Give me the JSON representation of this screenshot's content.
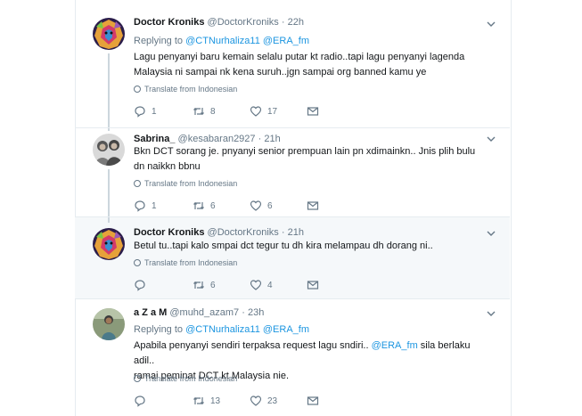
{
  "translate_label": "Translate from Indonesian",
  "tweets": [
    {
      "name": "Doctor Kroniks",
      "handle": "@DoctorKroniks",
      "time": "22h",
      "replying_prefix": "Replying to",
      "replying_to": [
        "@CTNurhaliza11",
        "@ERA_fm"
      ],
      "text_lines": [
        "Lagu penyanyi baru kemain selalu putar kt radio..tapi lagu penyanyi lagenda",
        "Malaysia ni sampai nk kena suruh..jgn sampai org banned kamu ye"
      ],
      "replies": "1",
      "retweets": "8",
      "likes": "17"
    },
    {
      "name": "Sabrina_",
      "handle": "@kesabaran2927",
      "time": "21h",
      "text_lines": [
        "Bkn DCT sorang je. pnyanyi senior prempuan lain pn xdimainkn.. Jnis plih bulu",
        "dn naikkn bbnu"
      ],
      "replies": "1",
      "retweets": "6",
      "likes": "6"
    },
    {
      "name": "Doctor Kroniks",
      "handle": "@DoctorKroniks",
      "time": "21h",
      "text_lines": [
        "Betul tu..tapi kalo smpai dct tegur tu dh kira melampau dh dorang ni.."
      ],
      "replies": "",
      "retweets": "6",
      "likes": "4"
    },
    {
      "name": "a Z a M",
      "handle": "@muhd_azam7",
      "time": "23h",
      "replying_prefix": "Replying to",
      "replying_to": [
        "@CTNurhaliza11",
        "@ERA_fm"
      ],
      "text_line1_a": "Apabila penyanyi sendiri terpaksa request lagu sndiri..",
      "text_line1_mention": "@ERA_fm",
      "text_line1_b": "sila berlaku adil..",
      "text_line2": "ramai peminat DCT kt Malaysia nie.",
      "replies": "",
      "retweets": "13",
      "likes": "23"
    }
  ],
  "colors": {
    "link": "#1b95e0",
    "muted": "#657786",
    "border": "#e6ecf0",
    "highlight": "#f5f8fa"
  },
  "icons": [
    "reply-icon",
    "retweet-icon",
    "like-icon",
    "dm-icon",
    "chevron-down-icon",
    "globe-icon"
  ]
}
